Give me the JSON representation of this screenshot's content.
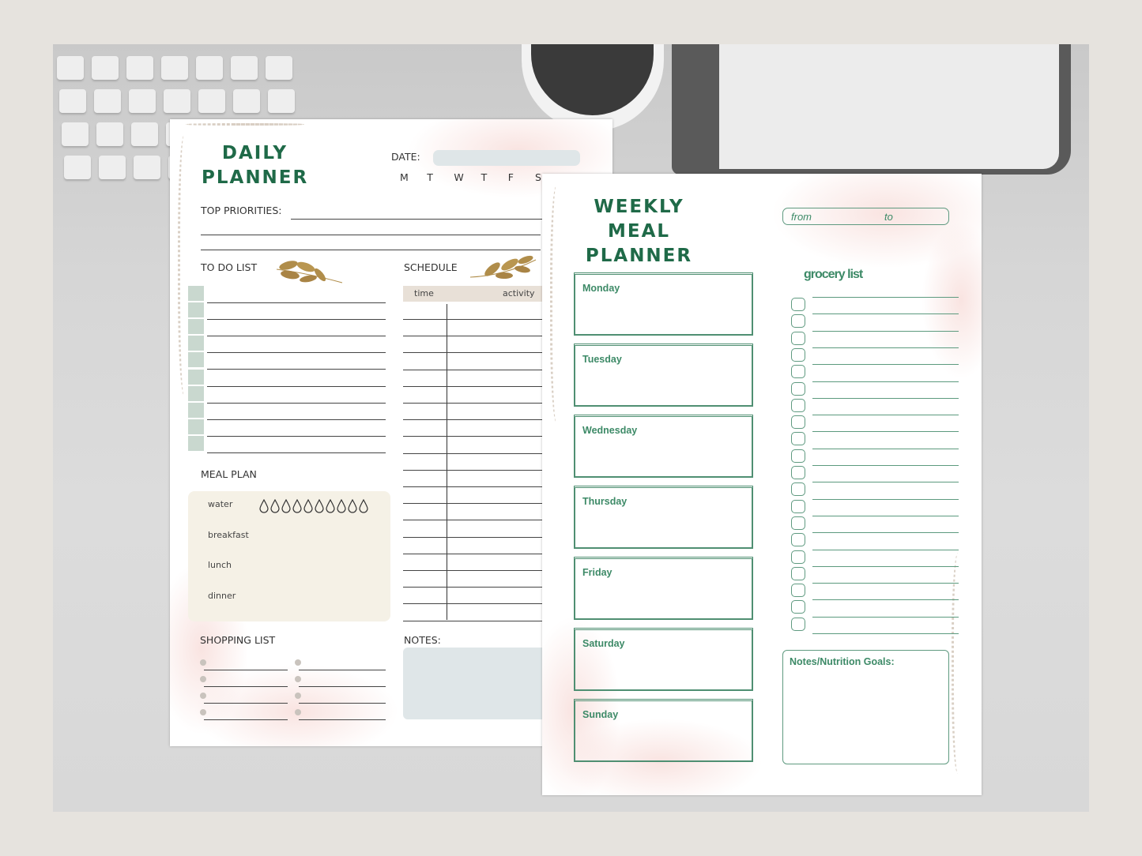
{
  "daily_planner": {
    "title_line1": "DAILY",
    "title_line2": "PLANNER",
    "date_label": "DATE:",
    "weekdays": [
      "M",
      "T",
      "W",
      "T",
      "F",
      "S"
    ],
    "top_priorities_label": "TOP PRIORITIES:",
    "todo_label": "TO DO LIST",
    "schedule_label": "SCHEDULE",
    "schedule_col_time": "time",
    "schedule_col_activity": "activity",
    "meal_plan_label": "MEAL PLAN",
    "meals": [
      "water",
      "breakfast",
      "lunch",
      "dinner"
    ],
    "water_drops": 10,
    "shopping_list_label": "SHOPPING LIST",
    "notes_label": "NOTES:",
    "todo_rows": 10,
    "schedule_rows": 19
  },
  "weekly_meal_planner": {
    "title_line1": "WEEKLY MEAL",
    "title_line2": "PLANNER",
    "from_label": "from",
    "to_label": "to",
    "days": [
      "Monday",
      "Tuesday",
      "Wednesday",
      "Thursday",
      "Friday",
      "Saturday",
      "Sunday"
    ],
    "grocery_label": "grocery list",
    "grocery_rows": 20,
    "notes_label": "Notes/Nutrition Goals:"
  },
  "colors": {
    "title_green": "#1f6a48",
    "accent_green": "#3d8a67",
    "todo_square": "#c9d8cf",
    "meal_box": "#f5f1e6",
    "date_box": "#dfe6e8",
    "schedule_header": "#e8e0d7",
    "leaf_gold": "#b08d4a"
  }
}
